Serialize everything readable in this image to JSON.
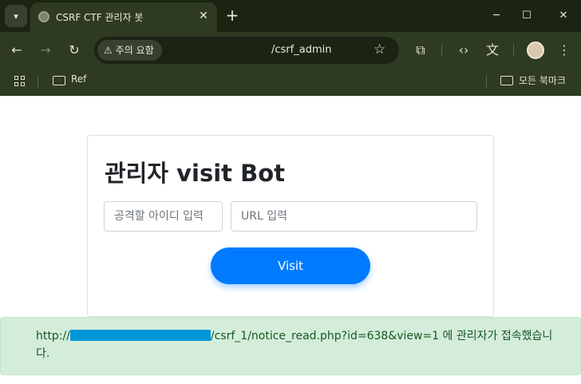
{
  "browser": {
    "tab_title": "CSRF CTF 관리자 봇",
    "security_chip": "주의 요함",
    "url": "/csrf_admin",
    "bookmarks": [
      {
        "label": "Ref"
      },
      {
        "label": "모든 북마크"
      }
    ]
  },
  "page": {
    "title": "관리자 visit Bot",
    "id_input": {
      "placeholder": "공격할 아이디 입력",
      "value": ""
    },
    "url_input": {
      "placeholder": "URL 입력",
      "value": ""
    },
    "visit_label": "Visit"
  },
  "alert": {
    "prefix": "http://",
    "suffix": "/csrf_1/notice_read.php?id=638&view=1 에 관리자가 접속했습니다.",
    "redaction_color": "#0097d9"
  },
  "colors": {
    "accent": "#007bff",
    "alert_bg": "#d4edda",
    "alert_text": "#155724",
    "chrome_bg": "#2f3a23"
  }
}
